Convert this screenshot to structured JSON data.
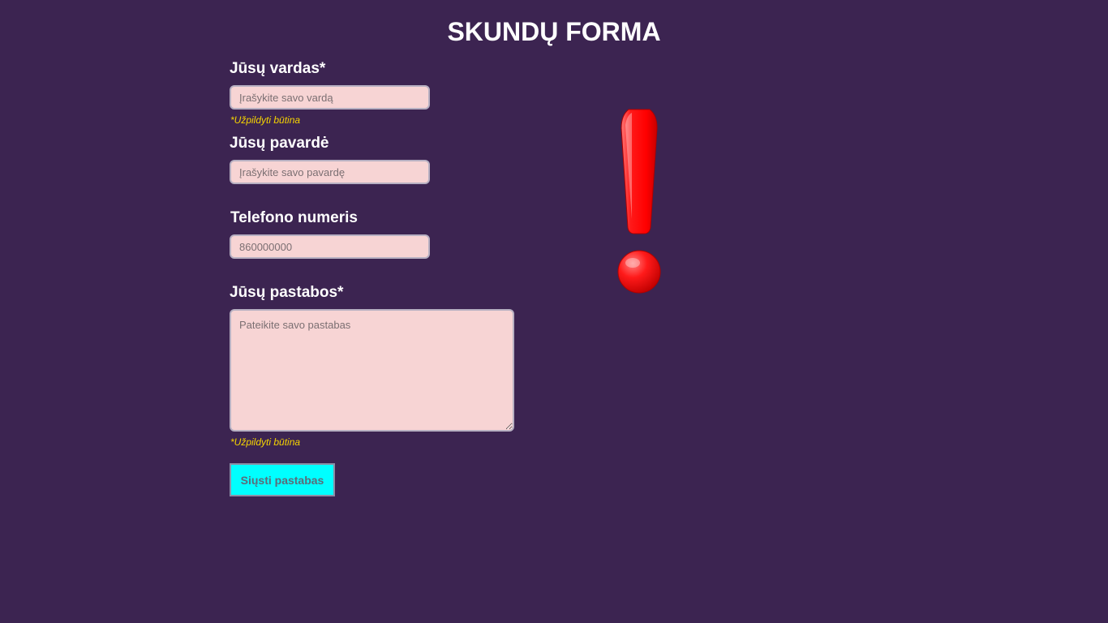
{
  "header": {
    "title": "SKUNDŲ FORMA"
  },
  "form": {
    "first_name": {
      "label": "Jūsų vardas*",
      "placeholder": "Įrašykite savo vardą",
      "value": "",
      "hint": "*Užpildyti būtina"
    },
    "last_name": {
      "label": "Jūsų pavardė",
      "placeholder": "Įrašykite savo pavardę",
      "value": ""
    },
    "phone": {
      "label": "Telefono numeris",
      "placeholder": "860000000",
      "value": ""
    },
    "comments": {
      "label": "Jūsų pastabos*",
      "placeholder": "Pateikite savo pastabas",
      "value": "",
      "hint": "*Užpildyti būtina"
    },
    "submit_label": "Siųsti pastabas"
  },
  "decoration": {
    "icon": "exclamation-mark-icon",
    "color": "#ff0000"
  },
  "colors": {
    "background": "#3c2451",
    "field_background": "#f7d4d4",
    "hint": "#f6d400",
    "button": "#00ffff"
  }
}
